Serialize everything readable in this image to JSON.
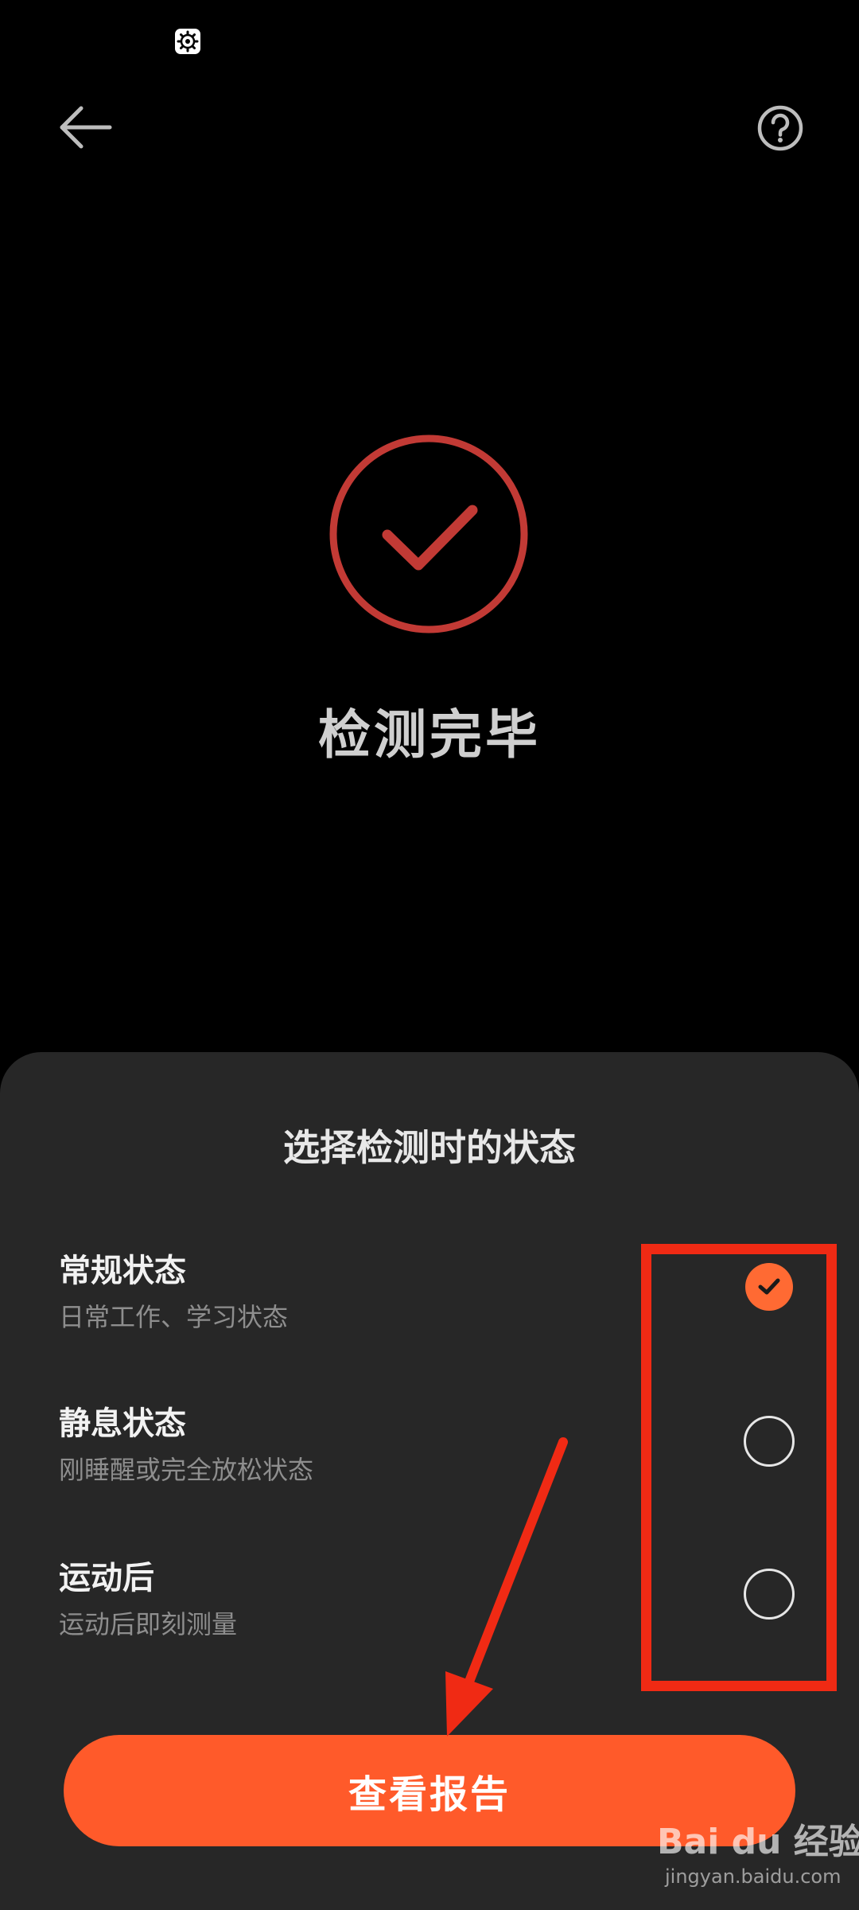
{
  "result": {
    "title": "检测完毕"
  },
  "sheet": {
    "title": "选择检测时的状态",
    "options": [
      {
        "title": "常规状态",
        "desc": "日常工作、学习状态",
        "selected": true
      },
      {
        "title": "静息状态",
        "desc": "刚睡醒或完全放松状态",
        "selected": false
      },
      {
        "title": "运动后",
        "desc": "运动后即刻测量",
        "selected": false
      }
    ]
  },
  "button": {
    "label": "查看报告"
  },
  "watermark": {
    "brand": "Bai du 经验",
    "url": "jingyan.baidu.com"
  },
  "colors": {
    "accent": "#ff5a2a",
    "check_circle": "#c23a35",
    "annotation": "#f02a14",
    "sheet_bg": "#272727",
    "background": "#000000"
  },
  "icons": {
    "status": "gear-icon",
    "back": "back-arrow-icon",
    "help": "help-icon",
    "result": "checkmark-circle-icon"
  }
}
